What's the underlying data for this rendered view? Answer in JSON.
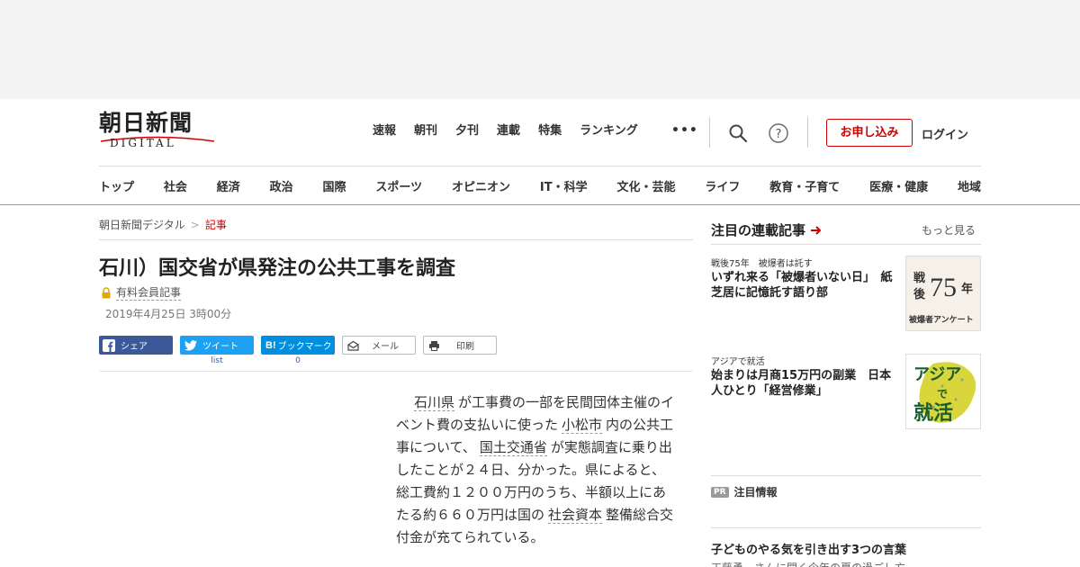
{
  "header": {
    "logo_main": "朝日新聞",
    "logo_sub": "DIGITAL",
    "top_nav": [
      "速報",
      "朝刊",
      "夕刊",
      "連載",
      "特集",
      "ランキング"
    ],
    "more_dots": "•••",
    "subscribe_label": "お申し込み",
    "login_label": "ログイン"
  },
  "categories": [
    "トップ",
    "社会",
    "経済",
    "政治",
    "国際",
    "スポーツ",
    "オピニオン",
    "IT・科学",
    "文化・芸能",
    "ライフ",
    "教育・子育て",
    "医療・健康",
    "地域"
  ],
  "breadcrumb": {
    "home": "朝日新聞デジタル",
    "sep": ">",
    "current": "記事"
  },
  "article": {
    "title": "石川）国交省が県発注の公共工事を調査",
    "paid_label": "有料会員記事",
    "date": "2019年4月25日 3時00分",
    "body": {
      "l1_link": "石川県",
      "l1_rest": "が工事費の一部を民間団体主催のイベント費の支払いに使った",
      "l2_link": "小松市",
      "l2_rest": "内の公共工事について、",
      "l3_link": "国土交通省",
      "l3_rest": "が実態調査に乗り出したことが２４日、分かった。県によると、総工費約１２００万円のうち、半額以上にあたる約６６０万円は国の",
      "l4_link": "社会資本",
      "l4_rest": "整備総合交付金が充てられている。"
    }
  },
  "share": {
    "facebook": "シェア",
    "twitter": "ツイート",
    "twitter_count": "list",
    "hatena": "ブックマーク",
    "hatena_count": "0",
    "mail": "メール",
    "print": "印刷"
  },
  "sidebar": {
    "title": "注目の連載記事",
    "more": "もっと見る",
    "items": [
      {
        "kicker": "戦後75年　被爆者は託す",
        "headline": "いずれ来る「被爆者いない日」　紙芝居に記憶託す語り部",
        "thumb_big": "戦後75年",
        "thumb_sub": "被爆者アンケート"
      },
      {
        "kicker": "アジアで就活",
        "headline": "始まりは月商15万円の副業　日本人ひとり「経営修業」",
        "thumb_big": "アジアで就活"
      }
    ],
    "pr_badge": "PR",
    "pr_label": "注目情報",
    "bottom_headline": "子どものやる気を引き出す3つの言葉",
    "bottom_sub": "工藤勇一さんに聞く今年の夏の過ごし方"
  },
  "colors": {
    "accent": "#cc0000",
    "facebook": "#3b5998",
    "twitter": "#1da1f2",
    "hatena": "#008fde"
  }
}
